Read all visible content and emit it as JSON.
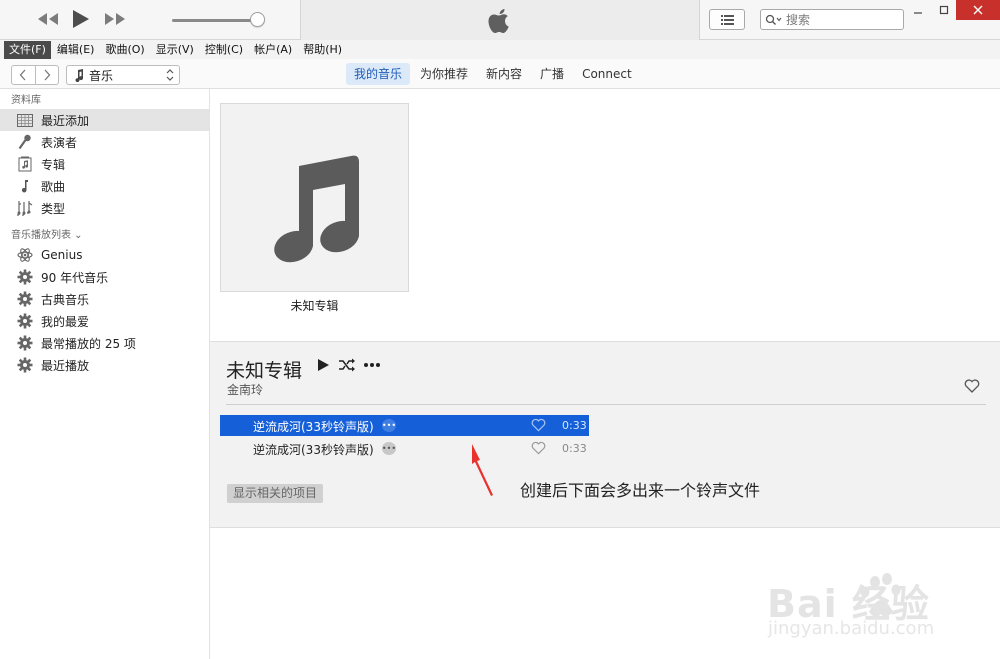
{
  "search": {
    "placeholder": "搜索"
  },
  "menu": [
    {
      "label": "文件(F)",
      "active": true
    },
    {
      "label": "编辑(E)"
    },
    {
      "label": "歌曲(O)"
    },
    {
      "label": "显示(V)"
    },
    {
      "label": "控制(C)"
    },
    {
      "label": "帐户(A)"
    },
    {
      "label": "帮助(H)"
    }
  ],
  "nav": {
    "media_selected": "音乐",
    "tabs": [
      {
        "label": "我的音乐",
        "active": true
      },
      {
        "label": "为你推荐"
      },
      {
        "label": "新内容"
      },
      {
        "label": "广播"
      },
      {
        "label": "Connect"
      }
    ]
  },
  "sidebar": {
    "library_title": "资料库",
    "library": [
      {
        "label": "最近添加",
        "icon": "grid-icon",
        "selected": true
      },
      {
        "label": "表演者",
        "icon": "microphone-icon"
      },
      {
        "label": "专辑",
        "icon": "album-icon"
      },
      {
        "label": "歌曲",
        "icon": "note-icon"
      },
      {
        "label": "类型",
        "icon": "genre-icon"
      }
    ],
    "playlists_title": "音乐播放列表 ⌄",
    "playlists": [
      {
        "label": "Genius",
        "icon": "genius-icon"
      },
      {
        "label": "90 年代音乐",
        "icon": "gear-icon"
      },
      {
        "label": "古典音乐",
        "icon": "gear-icon"
      },
      {
        "label": "我的最爱",
        "icon": "gear-icon"
      },
      {
        "label": "最常播放的 25 项",
        "icon": "gear-icon"
      },
      {
        "label": "最近播放",
        "icon": "gear-icon"
      }
    ]
  },
  "album": {
    "caption": "未知专辑",
    "title": "未知专辑",
    "artist": "金南玲",
    "tracks": [
      {
        "name": "逆流成河(33秒铃声版)",
        "duration": "0:33",
        "selected": true
      },
      {
        "name": "逆流成河(33秒铃声版)",
        "duration": "0:33",
        "selected": false
      }
    ],
    "related_button": "显示相关的项目"
  },
  "annotation": "创建后下面会多出来一个铃声文件",
  "watermark": {
    "brand": "Bai 经验",
    "url": "jingyan.baidu.com"
  },
  "colors": {
    "accent": "#1560d9",
    "tab_active_bg": "#dce9f9",
    "close_button": "#c8302b",
    "annotation_arrow": "#e8322d"
  }
}
